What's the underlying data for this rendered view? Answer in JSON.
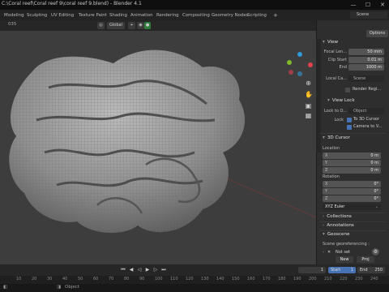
{
  "window": {
    "title": "C:\\Coral reef\\Coral reef 9\\coral reef 9.blend) - Blender 4.1",
    "controls": [
      "—",
      "☐",
      "✕"
    ]
  },
  "workspace_tabs": [
    {
      "label": "Modeling",
      "active": false
    },
    {
      "label": "Sculpting",
      "active": false
    },
    {
      "label": "UV Editing",
      "active": false
    },
    {
      "label": "Texture Paint",
      "active": false
    },
    {
      "label": "Shading",
      "active": false
    },
    {
      "label": "Animation",
      "active": false
    },
    {
      "label": "Rendering",
      "active": false
    },
    {
      "label": "Compositing",
      "active": false
    },
    {
      "label": "Geometry Nodes",
      "active": false
    },
    {
      "label": "Scripting",
      "active": false
    }
  ],
  "scene_field": "Scene",
  "viewport_header": {
    "frame_number": "035",
    "orientation": "Global"
  },
  "sidebar": {
    "options_label": "Options",
    "view": {
      "title": "View",
      "focal_length_label": "Focal Len...",
      "focal_length": "50 mm",
      "clip_start_label": "Clip Start",
      "clip_start": "0.01 m",
      "clip_end_label": "End",
      "clip_end": "1000 m",
      "local_camera_label": "Local Ca...",
      "local_camera_value": "Scene",
      "render_region_label": "Render Regi..."
    },
    "view_lock": {
      "title": "View Lock",
      "lock_to_object_label": "Lock to O...",
      "lock_to_object_placeholder": "Object",
      "lock_label": "Lock",
      "to_3d_cursor": "To 3D Cursor",
      "camera_to_view": "Camera to V..."
    },
    "cursor_3d": {
      "title": "3D Cursor",
      "location_label": "Location",
      "location": [
        {
          "axis": "X",
          "value": "0 m"
        },
        {
          "axis": "Y",
          "value": "0 m"
        },
        {
          "axis": "Z",
          "value": "0 m"
        }
      ],
      "rotation_label": "Rotation",
      "rotation": [
        {
          "axis": "X",
          "value": "0°"
        },
        {
          "axis": "Y",
          "value": "0°"
        },
        {
          "axis": "Z",
          "value": "0°"
        }
      ],
      "rotation_mode": "XYZ Euler"
    },
    "collections": {
      "title": "Collections"
    },
    "annotations": {
      "title": "Annotations"
    },
    "geoscene": {
      "title": "Geoscene",
      "georef_label": "Scene georeferencing :",
      "not_set": "Not set",
      "new_label": "New",
      "proj_label": "Proj"
    }
  },
  "timeline": {
    "current_frame": "1",
    "start_label": "Start",
    "start": "1",
    "end_label": "End",
    "end": "250",
    "ruler_ticks": [
      "10",
      "20",
      "30",
      "40",
      "50",
      "60",
      "70",
      "80",
      "90",
      "100",
      "110",
      "120",
      "130",
      "140",
      "150",
      "160",
      "170",
      "180",
      "190",
      "200",
      "210",
      "220",
      "230",
      "240"
    ]
  },
  "status": {
    "select": "",
    "object": "Object"
  },
  "colors": {
    "accent": "#4772b3",
    "viewport": "#3d3d3d",
    "panel": "#2e2e2e"
  }
}
